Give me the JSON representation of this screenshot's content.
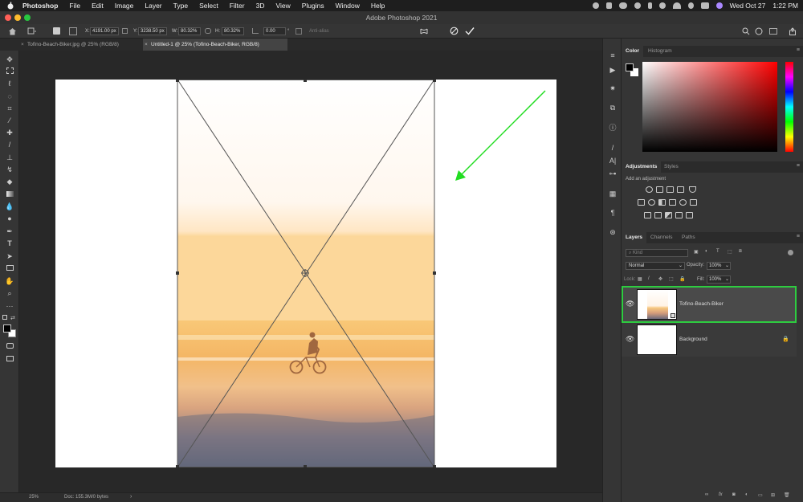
{
  "menubar": {
    "app": "Photoshop",
    "items": [
      "File",
      "Edit",
      "Image",
      "Layer",
      "Type",
      "Select",
      "Filter",
      "3D",
      "View",
      "Plugins",
      "Window",
      "Help"
    ],
    "datetime": "Wed Oct 27",
    "time": "1:22 PM"
  },
  "window": {
    "title": "Adobe Photoshop 2021"
  },
  "options": {
    "x_label": "X:",
    "x_value": "4191.00 px",
    "y_label": "Y:",
    "y_value": "3238.50 px",
    "w_label": "W:",
    "w_value": "80.32%",
    "h_label": "H:",
    "h_value": "80.32%",
    "angle_value": "0.00",
    "angle_unit": "°",
    "antialias_label": "Anti-alias"
  },
  "tabs": [
    {
      "label": "Tofino-Beach-Biker.jpg @ 25% (RGB/8)",
      "active": false
    },
    {
      "label": "Untitled-1 @ 25% (Tofino-Beach-Biker, RGB/8)",
      "active": true
    }
  ],
  "status": {
    "zoom": "25%",
    "doc": "Doc: 155.3M/0 bytes"
  },
  "color_panel": {
    "tabs": [
      "Color",
      "Histogram"
    ],
    "hue_base": "#ff0000"
  },
  "adjustments_panel": {
    "tabs": [
      "Adjustments",
      "Styles"
    ],
    "subtitle": "Add an adjustment"
  },
  "layers_panel": {
    "tabs": [
      "Layers",
      "Channels",
      "Paths"
    ],
    "kind_placeholder": "Kind",
    "blend_mode": "Normal",
    "opacity_label": "Opacity:",
    "opacity_value": "100%",
    "lock_label": "Lock:",
    "fill_label": "Fill:",
    "fill_value": "100%",
    "layers": [
      {
        "name": "Tofino-Beach-Biker",
        "selected": true,
        "locked": false
      },
      {
        "name": "Background",
        "selected": false,
        "locked": true
      }
    ]
  },
  "colors": {
    "accent": "#2ecc40",
    "selection": "#4a4a4a",
    "arrow": "#22dd22"
  }
}
